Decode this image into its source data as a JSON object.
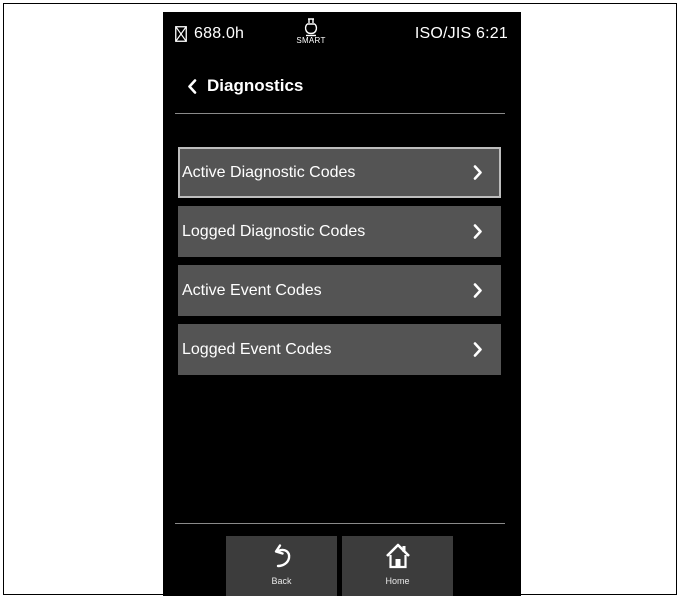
{
  "status_bar": {
    "hours": "688.0h",
    "mode_label": "SMART",
    "standard": "ISO/JIS",
    "time": "6:21"
  },
  "header": {
    "title": "Diagnostics"
  },
  "menu": {
    "items": [
      {
        "label": "Active Diagnostic Codes",
        "selected": true
      },
      {
        "label": "Logged Diagnostic Codes",
        "selected": false
      },
      {
        "label": "Active Event Codes",
        "selected": false
      },
      {
        "label": "Logged Event Codes",
        "selected": false
      }
    ]
  },
  "nav": {
    "back_label": "Back",
    "home_label": "Home"
  },
  "icons": {
    "hours": "hourglass-icon",
    "mode": "bulb-icon",
    "back": "chevron-left-icon",
    "menu_arrow": "chevron-right-icon",
    "back_button": "undo-arrow-icon",
    "home_button": "home-icon"
  },
  "colors": {
    "screen_background": "#000000",
    "menu_item_background": "#545454",
    "nav_button_background": "#3c3c3c",
    "selected_border": "#bdbdbd",
    "text": "#ffffff"
  }
}
